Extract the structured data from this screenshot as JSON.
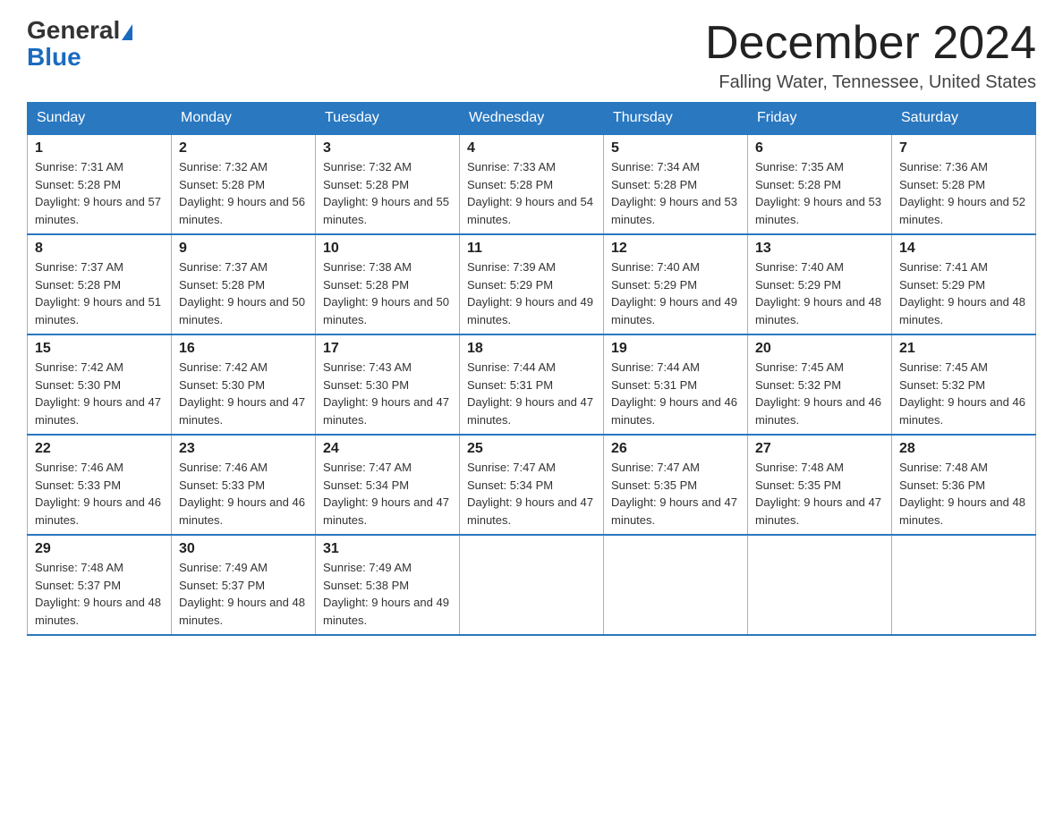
{
  "header": {
    "logo_general": "General",
    "logo_blue": "Blue",
    "month_title": "December 2024",
    "location": "Falling Water, Tennessee, United States"
  },
  "weekdays": [
    "Sunday",
    "Monday",
    "Tuesday",
    "Wednesday",
    "Thursday",
    "Friday",
    "Saturday"
  ],
  "weeks": [
    [
      {
        "day": "1",
        "sunrise": "7:31 AM",
        "sunset": "5:28 PM",
        "daylight": "9 hours and 57 minutes."
      },
      {
        "day": "2",
        "sunrise": "7:32 AM",
        "sunset": "5:28 PM",
        "daylight": "9 hours and 56 minutes."
      },
      {
        "day": "3",
        "sunrise": "7:32 AM",
        "sunset": "5:28 PM",
        "daylight": "9 hours and 55 minutes."
      },
      {
        "day": "4",
        "sunrise": "7:33 AM",
        "sunset": "5:28 PM",
        "daylight": "9 hours and 54 minutes."
      },
      {
        "day": "5",
        "sunrise": "7:34 AM",
        "sunset": "5:28 PM",
        "daylight": "9 hours and 53 minutes."
      },
      {
        "day": "6",
        "sunrise": "7:35 AM",
        "sunset": "5:28 PM",
        "daylight": "9 hours and 53 minutes."
      },
      {
        "day": "7",
        "sunrise": "7:36 AM",
        "sunset": "5:28 PM",
        "daylight": "9 hours and 52 minutes."
      }
    ],
    [
      {
        "day": "8",
        "sunrise": "7:37 AM",
        "sunset": "5:28 PM",
        "daylight": "9 hours and 51 minutes."
      },
      {
        "day": "9",
        "sunrise": "7:37 AM",
        "sunset": "5:28 PM",
        "daylight": "9 hours and 50 minutes."
      },
      {
        "day": "10",
        "sunrise": "7:38 AM",
        "sunset": "5:28 PM",
        "daylight": "9 hours and 50 minutes."
      },
      {
        "day": "11",
        "sunrise": "7:39 AM",
        "sunset": "5:29 PM",
        "daylight": "9 hours and 49 minutes."
      },
      {
        "day": "12",
        "sunrise": "7:40 AM",
        "sunset": "5:29 PM",
        "daylight": "9 hours and 49 minutes."
      },
      {
        "day": "13",
        "sunrise": "7:40 AM",
        "sunset": "5:29 PM",
        "daylight": "9 hours and 48 minutes."
      },
      {
        "day": "14",
        "sunrise": "7:41 AM",
        "sunset": "5:29 PM",
        "daylight": "9 hours and 48 minutes."
      }
    ],
    [
      {
        "day": "15",
        "sunrise": "7:42 AM",
        "sunset": "5:30 PM",
        "daylight": "9 hours and 47 minutes."
      },
      {
        "day": "16",
        "sunrise": "7:42 AM",
        "sunset": "5:30 PM",
        "daylight": "9 hours and 47 minutes."
      },
      {
        "day": "17",
        "sunrise": "7:43 AM",
        "sunset": "5:30 PM",
        "daylight": "9 hours and 47 minutes."
      },
      {
        "day": "18",
        "sunrise": "7:44 AM",
        "sunset": "5:31 PM",
        "daylight": "9 hours and 47 minutes."
      },
      {
        "day": "19",
        "sunrise": "7:44 AM",
        "sunset": "5:31 PM",
        "daylight": "9 hours and 46 minutes."
      },
      {
        "day": "20",
        "sunrise": "7:45 AM",
        "sunset": "5:32 PM",
        "daylight": "9 hours and 46 minutes."
      },
      {
        "day": "21",
        "sunrise": "7:45 AM",
        "sunset": "5:32 PM",
        "daylight": "9 hours and 46 minutes."
      }
    ],
    [
      {
        "day": "22",
        "sunrise": "7:46 AM",
        "sunset": "5:33 PM",
        "daylight": "9 hours and 46 minutes."
      },
      {
        "day": "23",
        "sunrise": "7:46 AM",
        "sunset": "5:33 PM",
        "daylight": "9 hours and 46 minutes."
      },
      {
        "day": "24",
        "sunrise": "7:47 AM",
        "sunset": "5:34 PM",
        "daylight": "9 hours and 47 minutes."
      },
      {
        "day": "25",
        "sunrise": "7:47 AM",
        "sunset": "5:34 PM",
        "daylight": "9 hours and 47 minutes."
      },
      {
        "day": "26",
        "sunrise": "7:47 AM",
        "sunset": "5:35 PM",
        "daylight": "9 hours and 47 minutes."
      },
      {
        "day": "27",
        "sunrise": "7:48 AM",
        "sunset": "5:35 PM",
        "daylight": "9 hours and 47 minutes."
      },
      {
        "day": "28",
        "sunrise": "7:48 AM",
        "sunset": "5:36 PM",
        "daylight": "9 hours and 48 minutes."
      }
    ],
    [
      {
        "day": "29",
        "sunrise": "7:48 AM",
        "sunset": "5:37 PM",
        "daylight": "9 hours and 48 minutes."
      },
      {
        "day": "30",
        "sunrise": "7:49 AM",
        "sunset": "5:37 PM",
        "daylight": "9 hours and 48 minutes."
      },
      {
        "day": "31",
        "sunrise": "7:49 AM",
        "sunset": "5:38 PM",
        "daylight": "9 hours and 49 minutes."
      },
      null,
      null,
      null,
      null
    ]
  ]
}
